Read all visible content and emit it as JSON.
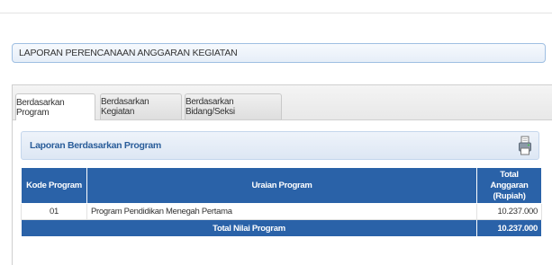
{
  "page_title": "LAPORAN PERENCANAAN ANGGARAN KEGIATAN",
  "tabs": [
    {
      "label": "Berdasarkan Program",
      "active": true
    },
    {
      "label": "Berdasarkan Kegiatan",
      "active": false
    },
    {
      "label": "Berdasarkan Bidang/Seksi",
      "active": false
    }
  ],
  "report": {
    "title": "Laporan Berdasarkan Program",
    "print_icon": "printer-icon",
    "columns": {
      "kode": "Kode Program",
      "uraian": "Uraian Program",
      "total_line1": "Total Anggaran",
      "total_line2": "(Rupiah)"
    },
    "rows": [
      {
        "kode": "01",
        "uraian": "Program Pendidikan Menegah Pertama",
        "total": "10.237.000"
      }
    ],
    "footer": {
      "label": "Total Nilai Program",
      "value": "10.237.000"
    }
  },
  "colors": {
    "header_blue": "#2a62a8",
    "title_text": "#2a5d9a"
  }
}
